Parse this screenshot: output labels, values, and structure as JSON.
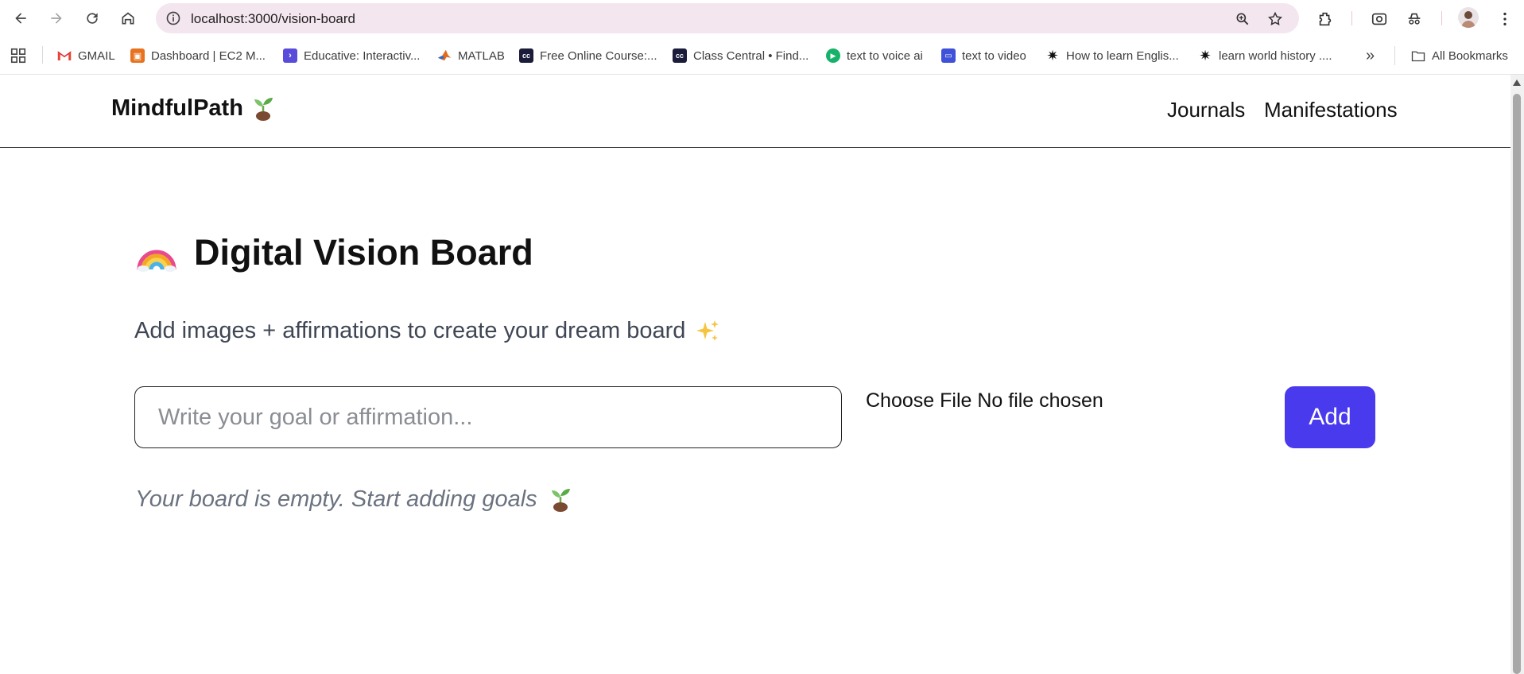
{
  "browser": {
    "url": "localhost:3000/vision-board",
    "bookmarks": [
      {
        "label": "GMAIL",
        "icon": "gmail-icon",
        "color": "#ea4335"
      },
      {
        "label": "Dashboard | EC2 M...",
        "icon": "aws-icon",
        "color": "#e8731f"
      },
      {
        "label": "Educative: Interactiv...",
        "icon": "educative-icon",
        "color": "#5a4cdb"
      },
      {
        "label": "MATLAB",
        "icon": "matlab-icon",
        "color": "#e26a1a"
      },
      {
        "label": "Free Online Course:...",
        "icon": "classcentral-icon",
        "color": "#1b1b3a"
      },
      {
        "label": "Class Central • Find...",
        "icon": "classcentral-icon",
        "color": "#1b1b3a"
      },
      {
        "label": "text to voice ai",
        "icon": "play-icon",
        "color": "#17b26a"
      },
      {
        "label": "text to video",
        "icon": "video-icon",
        "color": "#3f51d9"
      },
      {
        "label": "How to learn Englis...",
        "icon": "sparkle-icon",
        "color": "#111111"
      },
      {
        "label": "learn world history ....",
        "icon": "sparkle-icon",
        "color": "#111111"
      }
    ],
    "more_bookmarks_glyph": "»",
    "all_bookmarks_label": "All Bookmarks"
  },
  "site": {
    "brand": "MindfulPath",
    "nav_links": [
      "Journals",
      "Manifestations"
    ]
  },
  "page": {
    "title": "Digital Vision Board",
    "subtitle": "Add images + affirmations to create your dream board",
    "input_placeholder": "Write your goal or affirmation...",
    "file_picker_label": "Choose File No file chosen",
    "add_label": "Add",
    "empty_message": "Your board is empty. Start adding goals"
  },
  "colors": {
    "accent": "#4a3aed",
    "omnibox": "#f4e6ef"
  }
}
